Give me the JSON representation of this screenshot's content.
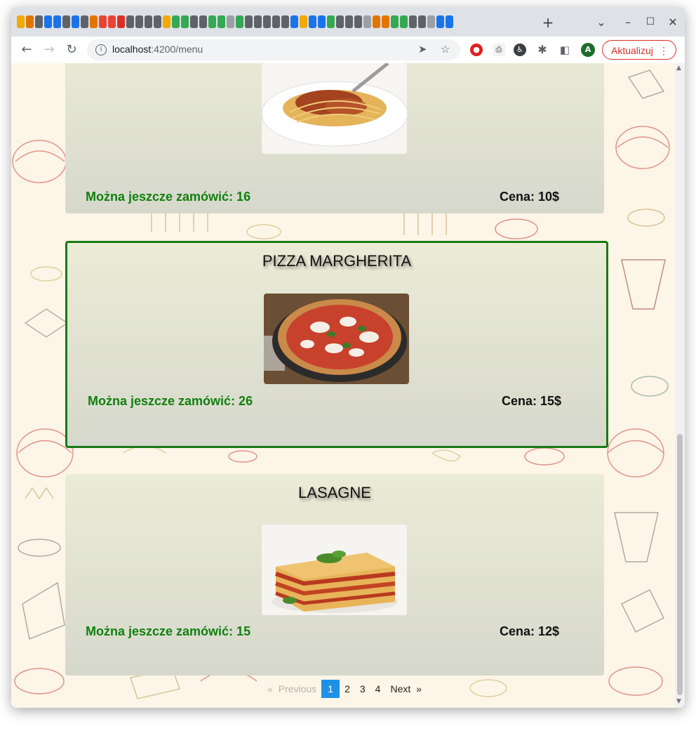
{
  "browser": {
    "url_host": "localhost",
    "url_path": ":4200/menu",
    "new_tab_label": "+",
    "update_label": "Aktualizuj",
    "avatar_letter": "A",
    "tab_icon_colors": [
      "#f2a900",
      "#e37400",
      "#5f6368",
      "#1a73e8",
      "#1a73e8",
      "#5f6368",
      "#1a73e8",
      "#5f6368",
      "#e37400",
      "#ea4335",
      "#ea4335",
      "#d93025",
      "#5f6368",
      "#5f6368",
      "#5f6368",
      "#5f6368",
      "#f2a900",
      "#34a853",
      "#34a853",
      "#5f6368",
      "#5f6368",
      "#34a853",
      "#34a853",
      "#9aa0a6",
      "#34a853",
      "#5f6368",
      "#5f6368",
      "#5f6368",
      "#5f6368",
      "#5f6368",
      "#1a73e8",
      "#f2a900",
      "#1a73e8",
      "#1a73e8",
      "#34a853",
      "#5f6368",
      "#5f6368",
      "#5f6368",
      "#9aa0a6",
      "#e37400",
      "#e37400",
      "#34a853",
      "#34a853",
      "#5f6368",
      "#5f6368",
      "#9aa0a6",
      "#1a73e8",
      "#1a73e8"
    ]
  },
  "menu": {
    "items": [
      {
        "name": "",
        "stock_label": "Można jeszcze zamówić: 16",
        "price_label": "Cena: 10$",
        "photo": "spaghetti"
      },
      {
        "name": "PIZZA MARGHERITA",
        "stock_label": "Można jeszcze zamówić: 26",
        "price_label": "Cena: 15$",
        "photo": "pizza"
      },
      {
        "name": "LASAGNE",
        "stock_label": "Można jeszcze zamówić: 15",
        "price_label": "Cena: 12$",
        "photo": "lasagne"
      }
    ]
  },
  "pagination": {
    "previous_label": "Previous",
    "next_label": "Next",
    "prev_arrow": "«",
    "next_arrow": "»",
    "pages": [
      "1",
      "2",
      "3",
      "4"
    ],
    "current_page": "1"
  },
  "colors": {
    "accent_selected": "#187a13",
    "stock_text": "#11800f",
    "pager_active": "#1e91e6",
    "update_button": "#d93025"
  }
}
